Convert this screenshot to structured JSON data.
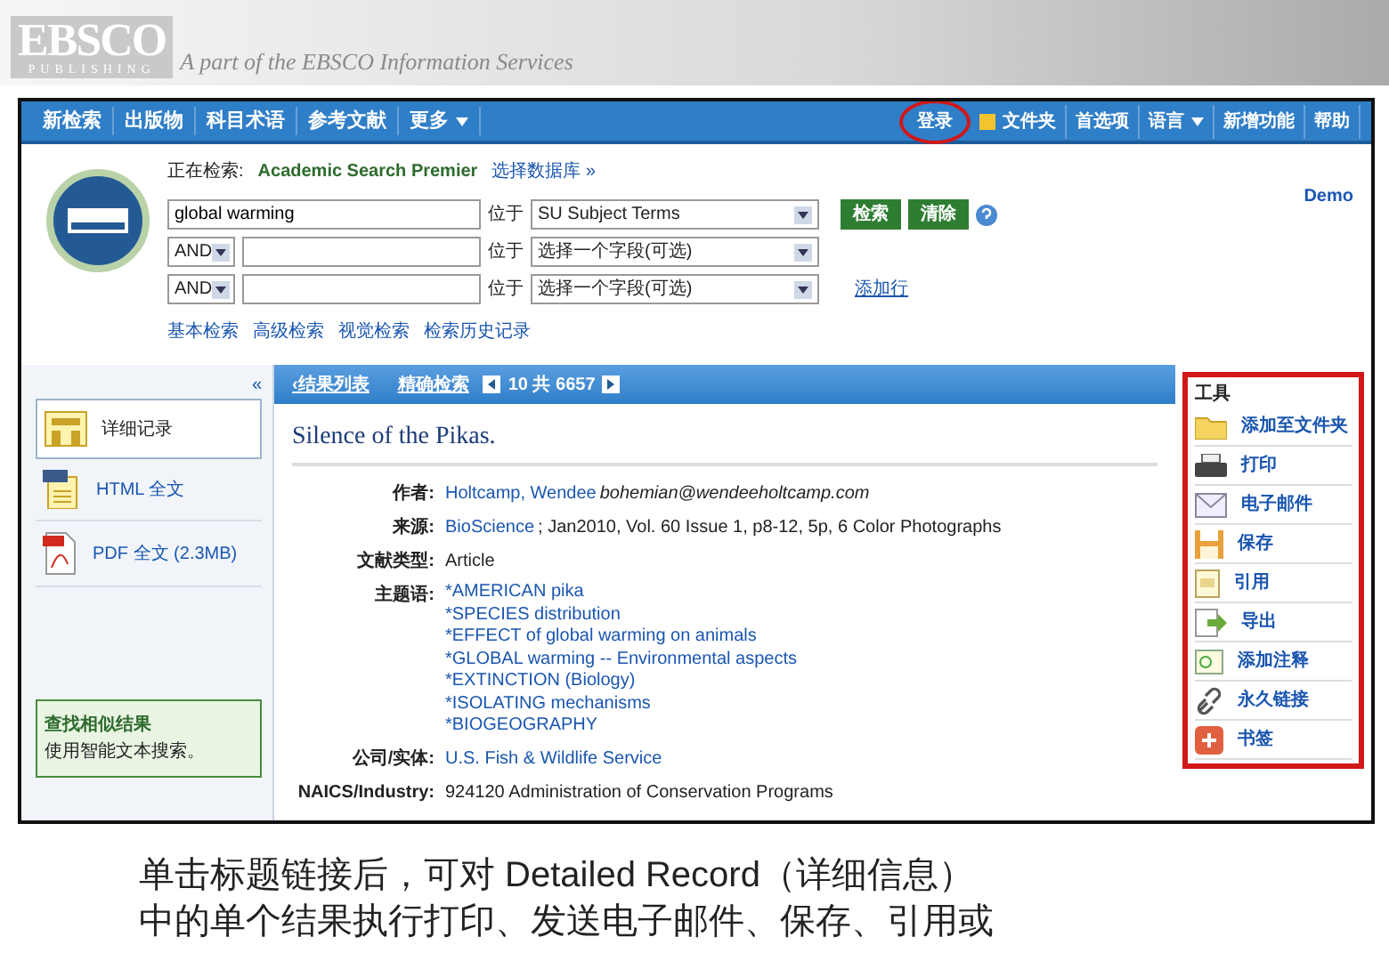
{
  "slide": {
    "logo_text": "EBSCO",
    "logo_subtext": "PUBLISHING",
    "tagline": "A part of the EBSCO Information Services"
  },
  "nav": {
    "left": [
      {
        "label": "新检索",
        "dropdown": false
      },
      {
        "label": "出版物",
        "dropdown": false
      },
      {
        "label": "科目术语",
        "dropdown": false
      },
      {
        "label": "参考文献",
        "dropdown": false
      },
      {
        "label": "更多",
        "dropdown": true
      }
    ],
    "right": [
      {
        "label": "登录",
        "circled": true,
        "dropdown": false,
        "kind": "text"
      },
      {
        "label": "文件夹",
        "circled": false,
        "dropdown": false,
        "kind": "folder"
      },
      {
        "label": "首选项",
        "circled": false,
        "dropdown": false,
        "kind": "text"
      },
      {
        "label": "语言",
        "circled": false,
        "dropdown": true,
        "kind": "text"
      },
      {
        "label": "新增功能",
        "circled": false,
        "dropdown": false,
        "kind": "text"
      },
      {
        "label": "帮助",
        "circled": false,
        "dropdown": false,
        "kind": "text"
      }
    ]
  },
  "search": {
    "searching_label": "正在检索:",
    "database": "Academic Search Premier",
    "choose_db": "选择数据库 »",
    "demo": "Demo",
    "rows": [
      {
        "operator": "",
        "value": "global warming",
        "in_label": "位于",
        "field": "SU Subject Terms"
      },
      {
        "operator": "AND",
        "value": "",
        "in_label": "位于",
        "field": "选择一个字段(可选)"
      },
      {
        "operator": "AND",
        "value": "",
        "in_label": "位于",
        "field": "选择一个字段(可选)"
      }
    ],
    "search_button": "检索",
    "clear_button": "清除",
    "add_row": "添加行",
    "links": [
      "基本检索",
      "高级检索",
      "视觉检索",
      "检索历史记录"
    ]
  },
  "left_panel": {
    "collapse": "«",
    "items": [
      {
        "label": "详细记录",
        "kind": "detail",
        "selected": true
      },
      {
        "label": "HTML 全文",
        "kind": "html",
        "selected": false
      },
      {
        "label": "PDF 全文 (2.3MB)",
        "kind": "pdf",
        "selected": false
      }
    ],
    "similar": {
      "title": "查找相似结果",
      "text": "使用智能文本搜索。"
    }
  },
  "record_bar": {
    "back": "‹结果列表",
    "refine": "精确检索",
    "position": "10 共 6657"
  },
  "record": {
    "title": "Silence of the Pikas.",
    "fields": [
      {
        "label": "作者:",
        "value": "Holtcamp, Wendee",
        "extra": "*bohemian@wendeeholtcamp.com*",
        "link": true
      },
      {
        "label": "来源:",
        "value": "BioScience",
        "extra": "; Jan2010, Vol. 60 Issue 1, p8-12, 5p, 6 Color Photographs",
        "link": true
      },
      {
        "label": "文献类型:",
        "value": "Article",
        "link": false
      },
      {
        "label": "主题语:",
        "values": [
          "*AMERICAN pika",
          "*SPECIES distribution",
          "*EFFECT of global warming on animals",
          "*GLOBAL warming -- Environmental aspects",
          "*EXTINCTION (Biology)",
          "*ISOLATING mechanisms",
          "*BIOGEOGRAPHY"
        ],
        "link": true
      },
      {
        "label": "公司/实体:",
        "value": "U.S. Fish & Wildlife Service",
        "link": true
      },
      {
        "label": "NAICS/Industry:",
        "value": "924120 Administration of Conservation Programs",
        "link": false
      }
    ]
  },
  "tools": {
    "outlined": true,
    "heading": "工具",
    "items": [
      {
        "label": "添加至文件夹",
        "kind": "folder"
      },
      {
        "label": "打印",
        "kind": "print"
      },
      {
        "label": "电子邮件",
        "kind": "email"
      },
      {
        "label": "保存",
        "kind": "save"
      },
      {
        "label": "引用",
        "kind": "cite"
      },
      {
        "label": "导出",
        "kind": "export"
      },
      {
        "label": "添加注释",
        "kind": "note"
      },
      {
        "label": "永久链接",
        "kind": "link"
      },
      {
        "label": "书签",
        "kind": "bookmark"
      }
    ]
  },
  "caption": [
    "单击标题链接后，可对 Detailed Record（详细信息）",
    "中的单个结果执行打印、发送电子邮件、保存、引用或"
  ]
}
